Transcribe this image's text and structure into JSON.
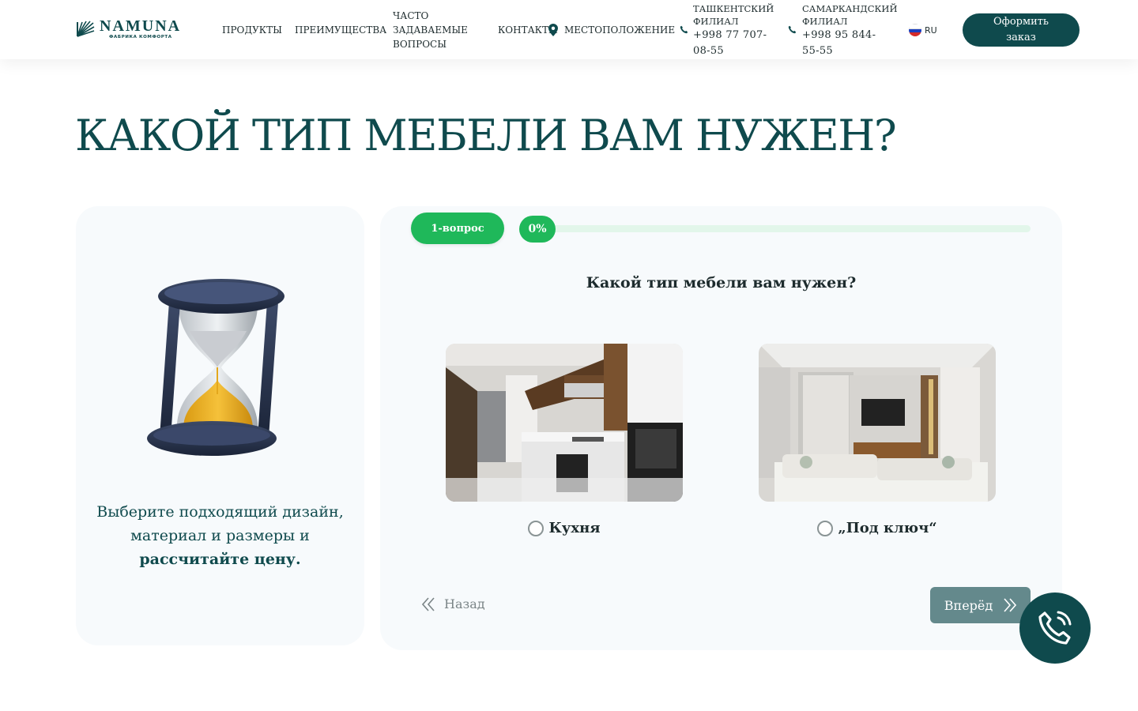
{
  "header": {
    "logo": {
      "name": "NAMUNA",
      "subtitle": "ФАБРИКА КОМФОРТА"
    },
    "nav": {
      "products": "ПРОДУКТЫ",
      "advantages": "ПРЕИМУЩЕСТВА",
      "faq": "ЧАСТО ЗАДАВАЕМЫЕ ВОПРОСЫ",
      "contacts": "КОНТАКТЫ",
      "location": "МЕСТОПОЛОЖЕНИЕ"
    },
    "branches": [
      {
        "label": "ТАШКЕНТСКИЙ ФИЛИАЛ",
        "phone": "+998 77 707-08-55"
      },
      {
        "label": "САМАРКАНДСКИЙ ФИЛИАЛ",
        "phone": "+998 95 844-55-55"
      }
    ],
    "language": "RU",
    "order_button": "Оформить заказ"
  },
  "page_title": "КАКОЙ ТИП МЕБЕЛИ ВАМ НУЖЕН?",
  "left_card": {
    "text_regular": "Выберите подходящий дизайн, материал и размеры и",
    "text_bold": "рассчитайте цену."
  },
  "quiz": {
    "step_label": "1-вопрос",
    "progress_text": "0%",
    "progress_value": 0,
    "question": "Какой тип мебели вам нужен?",
    "options": [
      {
        "label": "Кухня",
        "selected": false
      },
      {
        "label": "„Под ключ“",
        "selected": false
      }
    ],
    "back_label": "Назад",
    "next_label": "Вперёд"
  },
  "colors": {
    "brand": "#0f4a4d",
    "accent_green": "#1fb85a",
    "next_button": "#64898c"
  }
}
